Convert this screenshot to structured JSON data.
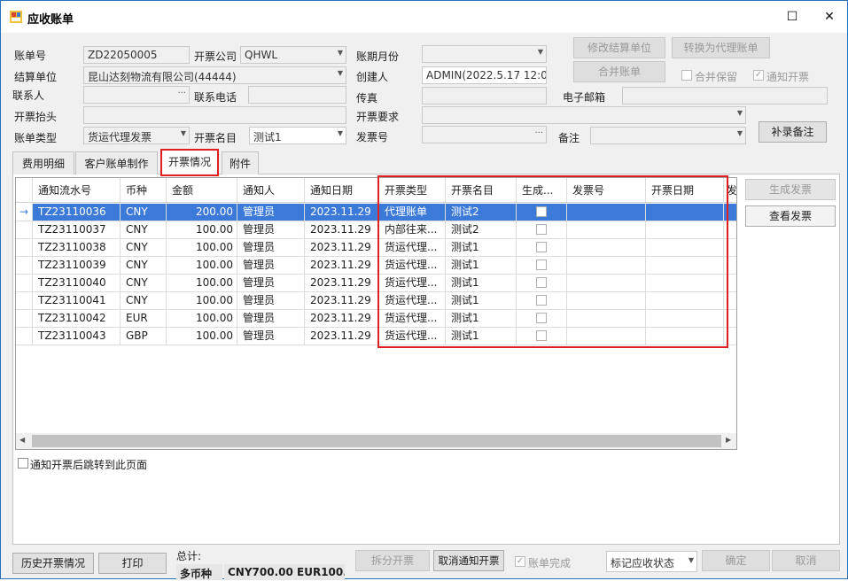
{
  "window": {
    "title": "应收账单"
  },
  "form": {
    "bill_no_label": "账单号",
    "bill_no": "ZD22050005",
    "invoice_company_label": "开票公司",
    "invoice_company": "QHWL",
    "period_label": "账期月份",
    "period": "",
    "modify_settle_btn": "修改结算单位",
    "convert_agent_btn": "转换为代理账单",
    "settle_unit_label": "结算单位",
    "settle_unit": "昆山达刻物流有限公司(44444)",
    "creator_label": "创建人",
    "creator": "ADMIN(2022.5.17 12:0(",
    "merge_btn": "合并账单",
    "merge_keep_label": "合并保留",
    "notify_invoice_label": "通知开票",
    "contact_label": "联系人",
    "contact": "",
    "phone_label": "联系电话",
    "phone": "",
    "fax_label": "传真",
    "fax": "",
    "email_label": "电子邮箱",
    "email": "",
    "invoice_header_label": "开票抬头",
    "invoice_header": "",
    "invoice_req_label": "开票要求",
    "invoice_req": "",
    "bill_type_label": "账单类型",
    "bill_type": "货运代理发票",
    "invoice_name_label": "开票名目",
    "invoice_name": "测试1",
    "invoice_no_label": "发票号",
    "invoice_no": "",
    "remark_label": "备注",
    "remark": "",
    "add_remark_btn": "补录备注"
  },
  "tabs": [
    "费用明细",
    "客户账单制作",
    "开票情况",
    "附件"
  ],
  "table": {
    "columns": [
      "通知流水号",
      "币种",
      "金额",
      "通知人",
      "通知日期",
      "开票类型",
      "开票名目",
      "生成...",
      "发票号",
      "开票日期",
      "发"
    ],
    "rows": [
      {
        "no": "TZ23110036",
        "cur": "CNY",
        "amt": "200.00",
        "who": "管理员",
        "date": "2023.11.29",
        "type": "代理账单",
        "name": "测试2"
      },
      {
        "no": "TZ23110037",
        "cur": "CNY",
        "amt": "100.00",
        "who": "管理员",
        "date": "2023.11.29",
        "type": "内部往来...",
        "name": "测试2"
      },
      {
        "no": "TZ23110038",
        "cur": "CNY",
        "amt": "100.00",
        "who": "管理员",
        "date": "2023.11.29",
        "type": "货运代理...",
        "name": "测试1"
      },
      {
        "no": "TZ23110039",
        "cur": "CNY",
        "amt": "100.00",
        "who": "管理员",
        "date": "2023.11.29",
        "type": "货运代理...",
        "name": "测试1"
      },
      {
        "no": "TZ23110040",
        "cur": "CNY",
        "amt": "100.00",
        "who": "管理员",
        "date": "2023.11.29",
        "type": "货运代理...",
        "name": "测试1"
      },
      {
        "no": "TZ23110041",
        "cur": "CNY",
        "amt": "100.00",
        "who": "管理员",
        "date": "2023.11.29",
        "type": "货运代理...",
        "name": "测试1"
      },
      {
        "no": "TZ23110042",
        "cur": "EUR",
        "amt": "100.00",
        "who": "管理员",
        "date": "2023.11.29",
        "type": "货运代理...",
        "name": "测试1"
      },
      {
        "no": "TZ23110043",
        "cur": "GBP",
        "amt": "100.00",
        "who": "管理员",
        "date": "2023.11.29",
        "type": "货运代理...",
        "name": "测试1"
      }
    ]
  },
  "side": {
    "gen_invoice_btn": "生成发票",
    "view_invoice_btn": "查看发票"
  },
  "notify_jump_label": "通知开票后跳转到此页面",
  "footer": {
    "history_btn": "历史开票情况",
    "print_btn": "打印",
    "total_label": "总计:",
    "multi_currency": "多币种",
    "total_value": "CNY700.00 EUR100.(",
    "split_btn": "拆分开票",
    "cancel_notify_btn": "取消通知开票",
    "bill_done_label": "账单完成",
    "status_select": "标记应收状态",
    "confirm_btn": "确定",
    "cancel_btn": "取消"
  },
  "colors": {
    "highlight": "#e02020",
    "selection": "#3b7ad9"
  }
}
